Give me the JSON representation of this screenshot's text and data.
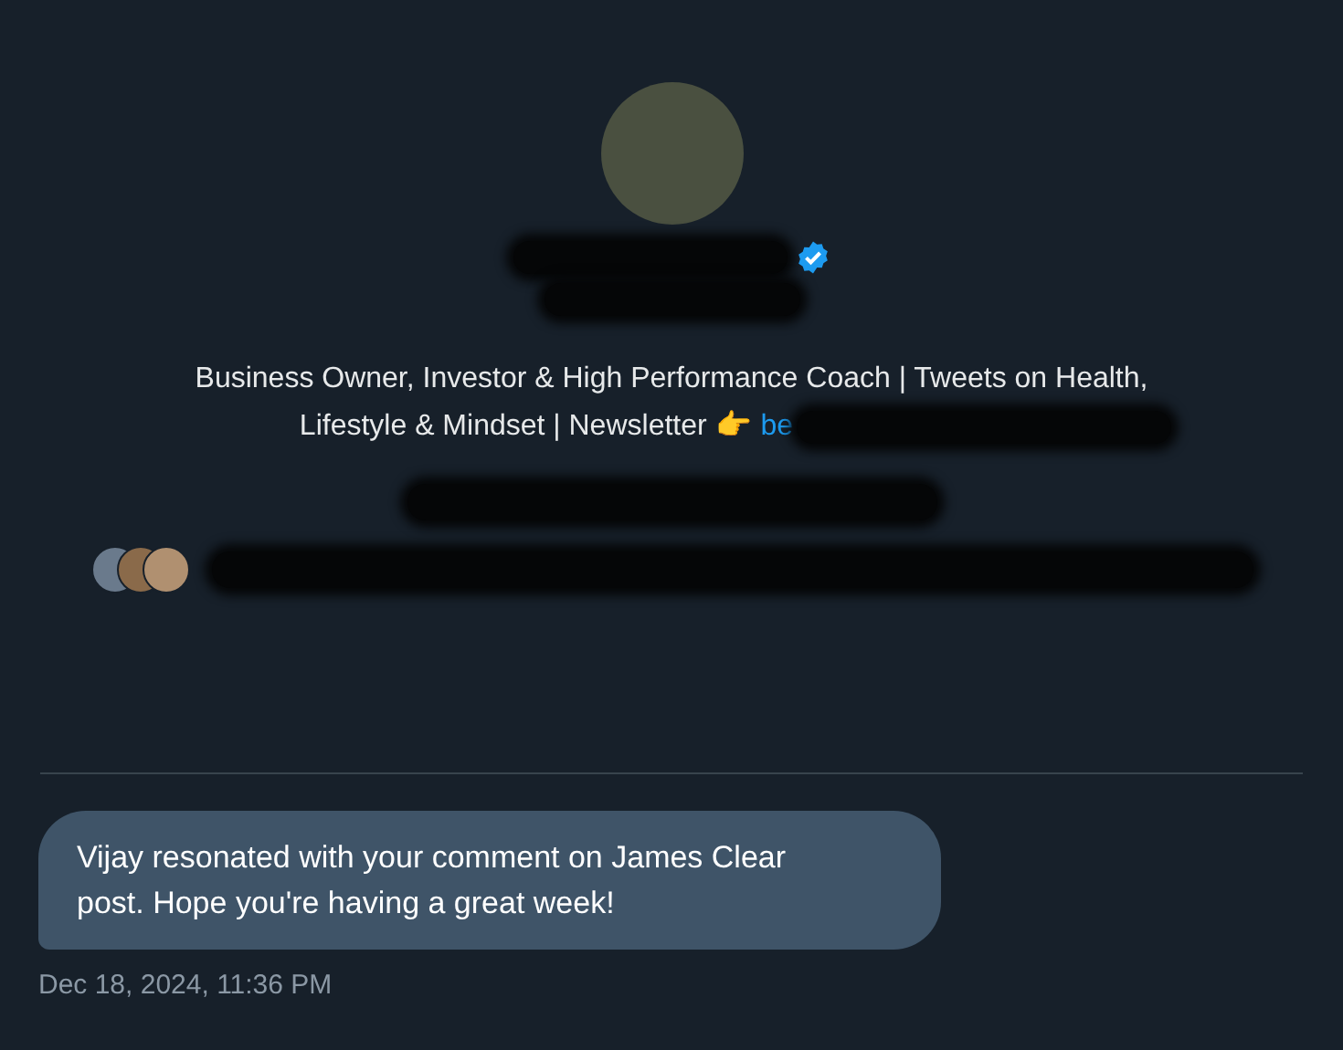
{
  "profile": {
    "bio_lines": [
      "Business Owner, Investor & High Performance Coach | Tweets on Health,",
      "Lifestyle & Mindset | Newsletter 👉"
    ],
    "link": "be",
    "verified": true
  },
  "message": {
    "text": "Vijay resonated with your comment on James Clear post. Hope you're having a great week!",
    "time": "Dec 18, 2024, 11:36 PM"
  }
}
